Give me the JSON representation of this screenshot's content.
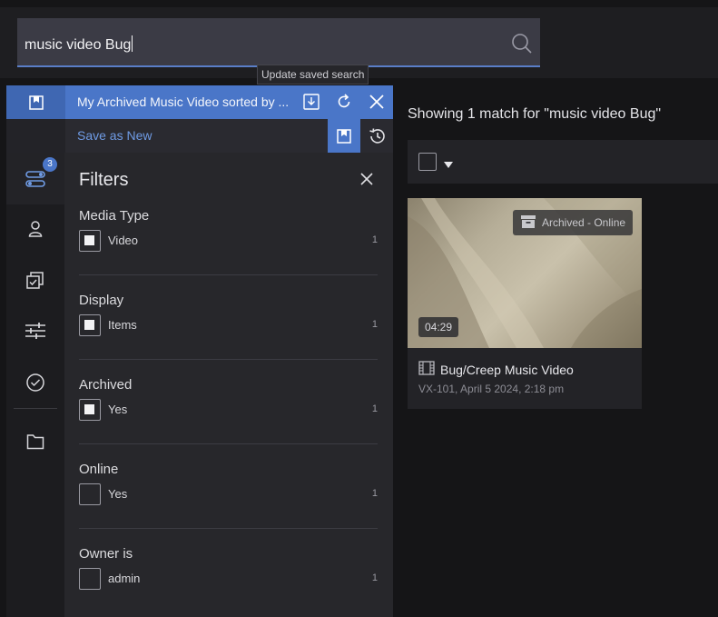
{
  "search": {
    "query": "music video Bug",
    "tooltip": "Update saved search"
  },
  "saved_search": {
    "title": "My Archived Music Video sorted by ...",
    "save_as_new": "Save as New"
  },
  "rail": {
    "filters_badge": "3",
    "icons": [
      "filters-icon",
      "person-icon",
      "collections-icon",
      "sliders-icon",
      "check-circle-icon",
      "folder-icon"
    ]
  },
  "filters": {
    "title": "Filters",
    "groups": [
      {
        "title": "Media Type",
        "option": "Video",
        "count": "1",
        "checked": true
      },
      {
        "title": "Display",
        "option": "Items",
        "count": "1",
        "checked": true
      },
      {
        "title": "Archived",
        "option": "Yes",
        "count": "1",
        "checked": true
      },
      {
        "title": "Online",
        "option": "Yes",
        "count": "1",
        "checked": false
      },
      {
        "title": "Owner is",
        "option": "admin",
        "count": "1",
        "checked": false
      }
    ]
  },
  "results": {
    "title": "Showing 1 match for  \"music video Bug\"",
    "card": {
      "badge": "Archived - Online",
      "duration": "04:29",
      "title": "Bug/Creep Music Video",
      "meta": "VX-101, April 5 2024, 2:18 pm"
    }
  },
  "colors": {
    "accent": "#4a76c8",
    "link": "#6f9be4",
    "background": "#151517"
  }
}
